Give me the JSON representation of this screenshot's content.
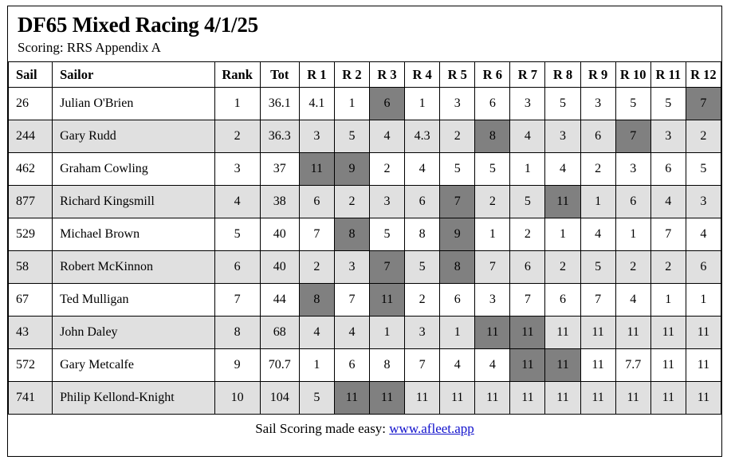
{
  "report": {
    "title": "DF65 Mixed Racing 4/1/25",
    "subtitle": "Scoring: RRS Appendix A"
  },
  "table": {
    "headers": {
      "sail": "Sail",
      "sailor": "Sailor",
      "rank": "Rank",
      "tot": "Tot",
      "races": [
        "R 1",
        "R 2",
        "R 3",
        "R 4",
        "R 5",
        "R 6",
        "R 7",
        "R 8",
        "R 9",
        "R 10",
        "R 11",
        "R 12"
      ]
    },
    "rows": [
      {
        "sail": "26",
        "sailor": "Julian O'Brien",
        "rank": "1",
        "tot": "36.1",
        "races": [
          "4.1",
          "1",
          "6",
          "1",
          "3",
          "6",
          "3",
          "5",
          "3",
          "5",
          "5",
          "7"
        ],
        "highlight": [
          false,
          false,
          true,
          false,
          false,
          false,
          false,
          false,
          false,
          false,
          false,
          true
        ]
      },
      {
        "sail": "244",
        "sailor": "Gary Rudd",
        "rank": "2",
        "tot": "36.3",
        "races": [
          "3",
          "5",
          "4",
          "4.3",
          "2",
          "8",
          "4",
          "3",
          "6",
          "7",
          "3",
          "2"
        ],
        "highlight": [
          false,
          false,
          false,
          false,
          false,
          true,
          false,
          false,
          false,
          true,
          false,
          false
        ]
      },
      {
        "sail": "462",
        "sailor": "Graham Cowling",
        "rank": "3",
        "tot": "37",
        "races": [
          "11",
          "9",
          "2",
          "4",
          "5",
          "5",
          "1",
          "4",
          "2",
          "3",
          "6",
          "5"
        ],
        "highlight": [
          true,
          true,
          false,
          false,
          false,
          false,
          false,
          false,
          false,
          false,
          false,
          false
        ]
      },
      {
        "sail": "877",
        "sailor": "Richard Kingsmill",
        "rank": "4",
        "tot": "38",
        "races": [
          "6",
          "2",
          "3",
          "6",
          "7",
          "2",
          "5",
          "11",
          "1",
          "6",
          "4",
          "3"
        ],
        "highlight": [
          false,
          false,
          false,
          false,
          true,
          false,
          false,
          true,
          false,
          false,
          false,
          false
        ]
      },
      {
        "sail": "529",
        "sailor": "Michael Brown",
        "rank": "5",
        "tot": "40",
        "races": [
          "7",
          "8",
          "5",
          "8",
          "9",
          "1",
          "2",
          "1",
          "4",
          "1",
          "7",
          "4"
        ],
        "highlight": [
          false,
          true,
          false,
          false,
          true,
          false,
          false,
          false,
          false,
          false,
          false,
          false
        ]
      },
      {
        "sail": "58",
        "sailor": "Robert McKinnon",
        "rank": "6",
        "tot": "40",
        "races": [
          "2",
          "3",
          "7",
          "5",
          "8",
          "7",
          "6",
          "2",
          "5",
          "2",
          "2",
          "6"
        ],
        "highlight": [
          false,
          false,
          true,
          false,
          true,
          false,
          false,
          false,
          false,
          false,
          false,
          false
        ]
      },
      {
        "sail": "67",
        "sailor": "Ted Mulligan",
        "rank": "7",
        "tot": "44",
        "races": [
          "8",
          "7",
          "11",
          "2",
          "6",
          "3",
          "7",
          "6",
          "7",
          "4",
          "1",
          "1"
        ],
        "highlight": [
          true,
          false,
          true,
          false,
          false,
          false,
          false,
          false,
          false,
          false,
          false,
          false
        ]
      },
      {
        "sail": "43",
        "sailor": "John Daley",
        "rank": "8",
        "tot": "68",
        "races": [
          "4",
          "4",
          "1",
          "3",
          "1",
          "11",
          "11",
          "11",
          "11",
          "11",
          "11",
          "11"
        ],
        "highlight": [
          false,
          false,
          false,
          false,
          false,
          true,
          true,
          false,
          false,
          false,
          false,
          false
        ]
      },
      {
        "sail": "572",
        "sailor": "Gary Metcalfe",
        "rank": "9",
        "tot": "70.7",
        "races": [
          "1",
          "6",
          "8",
          "7",
          "4",
          "4",
          "11",
          "11",
          "11",
          "7.7",
          "11",
          "11"
        ],
        "highlight": [
          false,
          false,
          false,
          false,
          false,
          false,
          true,
          true,
          false,
          false,
          false,
          false
        ]
      },
      {
        "sail": "741",
        "sailor": "Philip Kellond-Knight",
        "rank": "10",
        "tot": "104",
        "races": [
          "5",
          "11",
          "11",
          "11",
          "11",
          "11",
          "11",
          "11",
          "11",
          "11",
          "11",
          "11"
        ],
        "highlight": [
          false,
          true,
          true,
          false,
          false,
          false,
          false,
          false,
          false,
          false,
          false,
          false
        ]
      }
    ]
  },
  "footer": {
    "text": "Sail Scoring made easy: ",
    "link_label": "www.afleet.app"
  },
  "colors": {
    "highlight_bg": "#808080",
    "highlight_text": "#ffffff",
    "alt_row_bg": "#e0e0e0",
    "link": "#1111cc",
    "border": "#000000"
  }
}
